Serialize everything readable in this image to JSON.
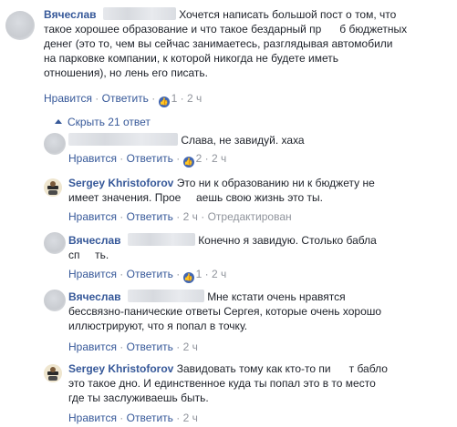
{
  "top_comment": {
    "author": "Вячеслав",
    "lines": [
      "Хочется написать большой пост о том, что",
      "такое хорошее образование и что такое бездарный пр      б бюджетных",
      "денег (это то, чем вы сейчас занимаетесь, разглядывая автомобили",
      "на парковке компании, к которой никогда не будете иметь",
      "отношения), но лень его писать."
    ],
    "actions": {
      "like": "Нравится",
      "reply": "Ответить",
      "likes": "1",
      "time": "2 ч"
    }
  },
  "hide_replies_label": "Скрыть 21 ответ",
  "replies": [
    {
      "id": "r1",
      "author": "",
      "lines": [
        "Слава, не завидуй. хаха"
      ],
      "actions": {
        "like": "Нравится",
        "reply": "Ответить",
        "likes": "2",
        "time": "2 ч"
      }
    },
    {
      "id": "r2",
      "author": "Sergey Khristoforov",
      "lines": [
        "Это ни к образованию ни к бюджету не",
        "имеет значения. Прое     аешь свою жизнь это ты."
      ],
      "actions": {
        "like": "Нравится",
        "reply": "Ответить",
        "time": "2 ч",
        "edited": "Отредактирован"
      }
    },
    {
      "id": "r3",
      "author": "Вячеслав",
      "lines": [
        "Конечно я завидую. Столько бабла",
        "сп     ть."
      ],
      "actions": {
        "like": "Нравится",
        "reply": "Ответить",
        "likes": "1",
        "time": "2 ч"
      }
    },
    {
      "id": "r4",
      "author": "Вячеслав",
      "lines": [
        "Мне кстати очень нравятся",
        "бессвязно-панические ответы Сергея, которые очень хорошо",
        "иллюстрируют, что я попал в точку."
      ],
      "actions": {
        "like": "Нравится",
        "reply": "Ответить",
        "time": "2 ч"
      }
    },
    {
      "id": "r5",
      "author": "Sergey Khristoforov",
      "lines": [
        "Завидовать тому как кто-то пи      т бабло",
        "это такое дно. И единственное куда ты попал это в то место",
        "где ты заслуживаешь быть."
      ],
      "actions": {
        "like": "Нравится",
        "reply": "Ответить",
        "time": "2 ч"
      }
    }
  ]
}
